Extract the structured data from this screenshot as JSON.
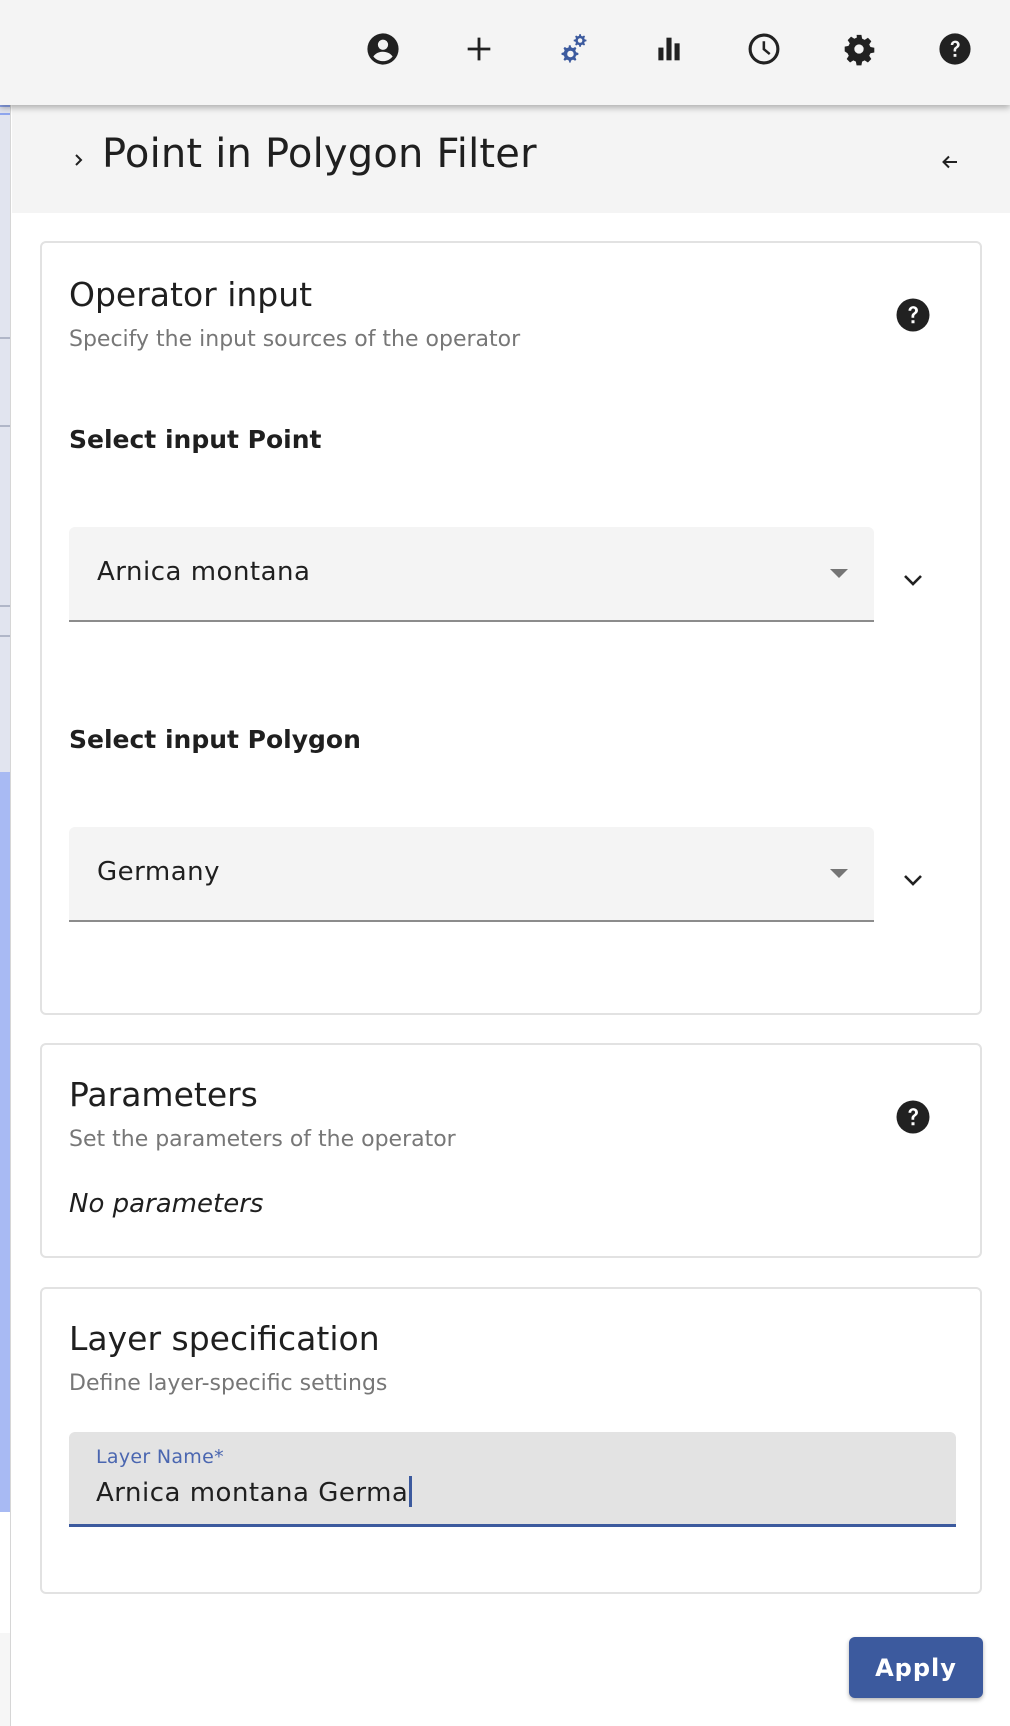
{
  "toolbar": {
    "icons": [
      {
        "name": "account-icon",
        "label": "account"
      },
      {
        "name": "add-icon",
        "label": "add"
      },
      {
        "name": "operators-icon",
        "label": "operators",
        "active": true
      },
      {
        "name": "plots-icon",
        "label": "plots"
      },
      {
        "name": "time-icon",
        "label": "time"
      },
      {
        "name": "settings-icon",
        "label": "settings"
      },
      {
        "name": "help-icon",
        "label": "help"
      }
    ],
    "active_color": "#3c5a9e",
    "icon_color": "#212121"
  },
  "panel": {
    "title": "Point in Polygon Filter"
  },
  "operator_input": {
    "title": "Operator input",
    "subtitle": "Specify the input sources of the operator",
    "point_label": "Select input Point",
    "point_value": "Arnica montana",
    "polygon_label": "Select input Polygon",
    "polygon_value": "Germany"
  },
  "parameters": {
    "title": "Parameters",
    "subtitle": "Set the parameters of the operator",
    "empty_text": "No parameters"
  },
  "layer_spec": {
    "title": "Layer specification",
    "subtitle": "Define layer-specific settings",
    "name_label": "Layer Name*",
    "name_value": "Arnica montana Germa"
  },
  "actions": {
    "apply_label": "Apply"
  },
  "colors": {
    "primary": "#3c5a9e",
    "panel_bg": "#f4f4f4",
    "map_water": "#a8baf3"
  }
}
